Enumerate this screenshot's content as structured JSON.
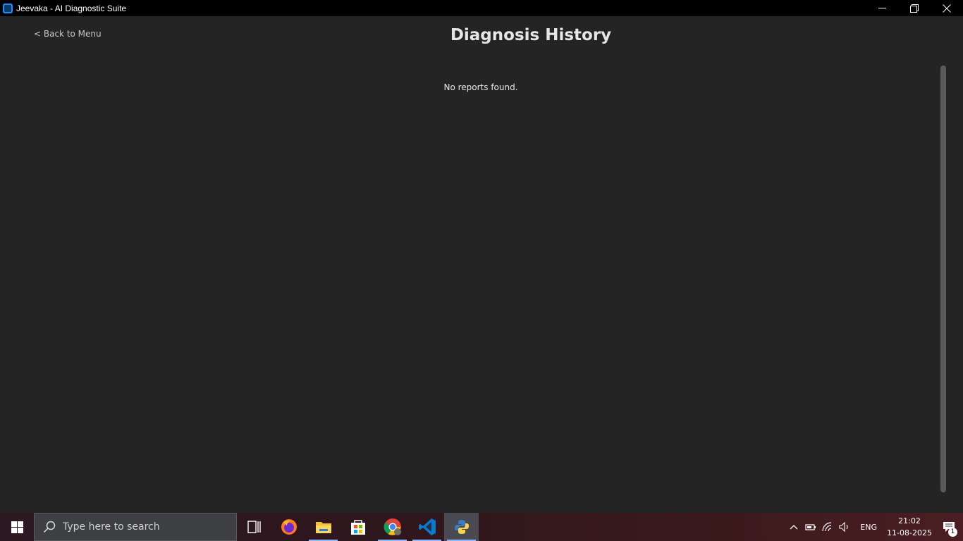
{
  "window": {
    "title": "Jeevaka - AI Diagnostic Suite",
    "minimize_glyph": "—",
    "restore_glyph": "❐",
    "close_glyph": "✕"
  },
  "page": {
    "back_label": "< Back to Menu",
    "title": "Diagnosis History",
    "empty_message": "No reports found."
  },
  "taskbar": {
    "search_placeholder": "Type here to search",
    "apps": [
      {
        "name": "task-view-icon",
        "running": false
      },
      {
        "name": "firefox-icon",
        "running": false
      },
      {
        "name": "file-explorer-icon",
        "running": true
      },
      {
        "name": "microsoft-store-icon",
        "running": false
      },
      {
        "name": "chrome-icon",
        "running": true
      },
      {
        "name": "vscode-icon",
        "running": true
      },
      {
        "name": "python-icon",
        "running": true,
        "active": true
      }
    ],
    "tray": {
      "language": "ENG",
      "time": "21:02",
      "date": "11-08-2025",
      "notification_count": "1"
    }
  },
  "colors": {
    "background": "#242424",
    "titlebar": "#000000",
    "accent": "#1f8fff"
  }
}
